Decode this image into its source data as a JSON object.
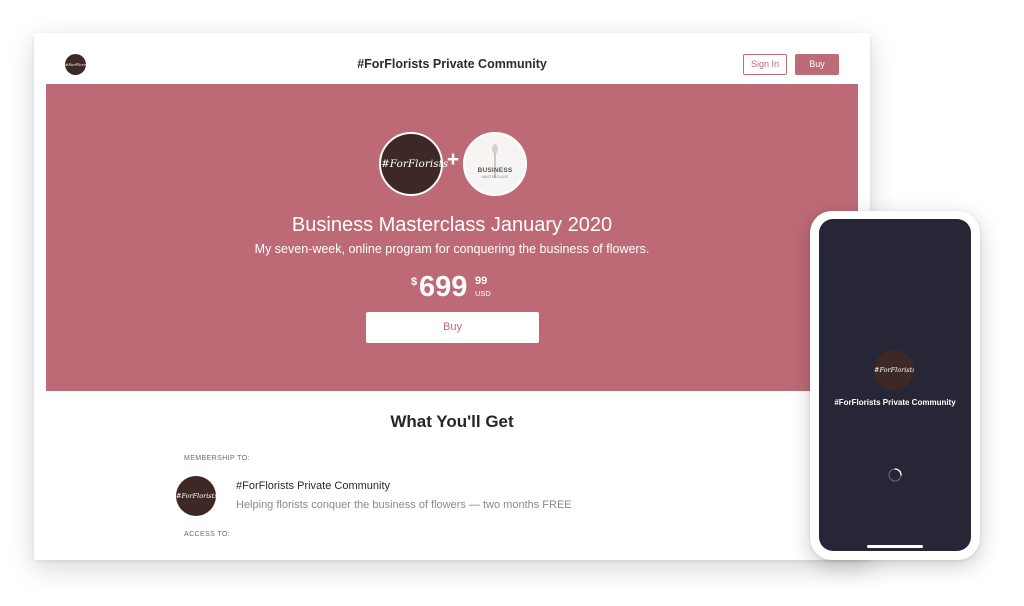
{
  "header": {
    "brand_logo_text": "#ForFlorists",
    "title": "#ForFlorists Private Community",
    "signin_label": "Sign In",
    "buy_label": "Buy"
  },
  "hero": {
    "brand_avatar_text": "#ForFlorists",
    "plus": "+",
    "course_image_label": "BUSINESS",
    "course_image_sub": "MASTERCLASS",
    "title": "Business Masterclass January 2020",
    "subtitle": "My seven-week, online program for conquering the business of flowers.",
    "price": {
      "currency_symbol": "$",
      "whole": "699",
      "cents": "99",
      "currency_code": "USD"
    },
    "buy_label": "Buy"
  },
  "offer": {
    "title": "What You'll Get",
    "membership_label": "MEMBERSHIP TO:",
    "community": {
      "logo_text": "#ForFlorists",
      "name": "#ForFlorists Private Community",
      "description": "Helping florists conquer the business of flowers — two months FREE"
    },
    "access_label": "ACCESS TO:"
  },
  "phone": {
    "logo_text": "#ForFlorists",
    "title": "#ForFlorists Private Community"
  },
  "colors": {
    "accent": "#bd6a76",
    "logo_dark": "#3d2826",
    "phone_bg": "#262636"
  }
}
